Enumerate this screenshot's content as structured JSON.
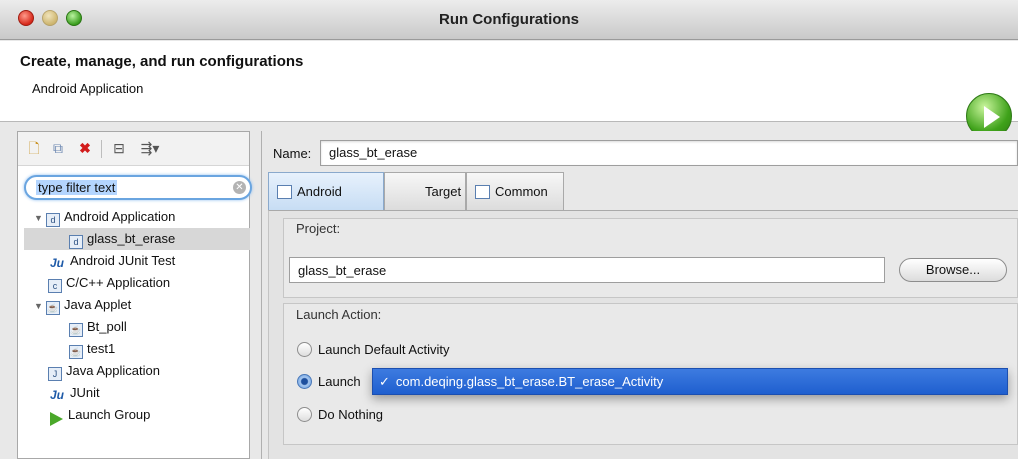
{
  "window": {
    "title": "Run Configurations"
  },
  "header": {
    "title": "Create, manage, and run configurations",
    "subtitle": "Android Application"
  },
  "left_panel": {
    "toolbar": {
      "items": [
        {
          "name": "new-launch-config-icon"
        },
        {
          "name": "duplicate-icon"
        },
        {
          "name": "delete-icon"
        },
        {
          "name": "collapse-all-icon"
        },
        {
          "name": "filter-icon"
        }
      ]
    },
    "filter": {
      "value": "type filter text"
    },
    "tree": [
      {
        "label": "Android Application",
        "level": 0,
        "expanded": true,
        "icon": "android-app-icon"
      },
      {
        "label": "glass_bt_erase",
        "level": 1,
        "selected": true,
        "icon": "android-app-icon"
      },
      {
        "label": "Android JUnit Test",
        "level": 0,
        "icon": "junit-icon"
      },
      {
        "label": "C/C++ Application",
        "level": 0,
        "icon": "c-app-icon"
      },
      {
        "label": "Java Applet",
        "level": 0,
        "expanded": true,
        "icon": "applet-icon"
      },
      {
        "label": "Bt_poll",
        "level": 1,
        "icon": "applet-icon"
      },
      {
        "label": "test1",
        "level": 1,
        "icon": "applet-icon"
      },
      {
        "label": "Java Application",
        "level": 0,
        "icon": "java-app-icon"
      },
      {
        "label": "JUnit",
        "level": 0,
        "icon": "junit-icon"
      },
      {
        "label": "Launch Group",
        "level": 0,
        "icon": "launch-group-icon"
      }
    ]
  },
  "right_panel": {
    "name_label": "Name:",
    "name_value": "glass_bt_erase",
    "tabs": [
      {
        "label": "Android",
        "active": true
      },
      {
        "label": "Target"
      },
      {
        "label": "Common"
      }
    ],
    "project": {
      "label": "Project:",
      "value": "glass_bt_erase",
      "browse_label": "Browse..."
    },
    "launch_action": {
      "label": "Launch Action:",
      "options": [
        {
          "label": "Launch Default Activity",
          "selected": false
        },
        {
          "label": "Launch",
          "selected": true
        },
        {
          "label": "Do Nothing",
          "selected": false
        }
      ],
      "activity_check": "✓",
      "activity": "com.deqing.glass_bt_erase.BT_erase_Activity"
    }
  }
}
